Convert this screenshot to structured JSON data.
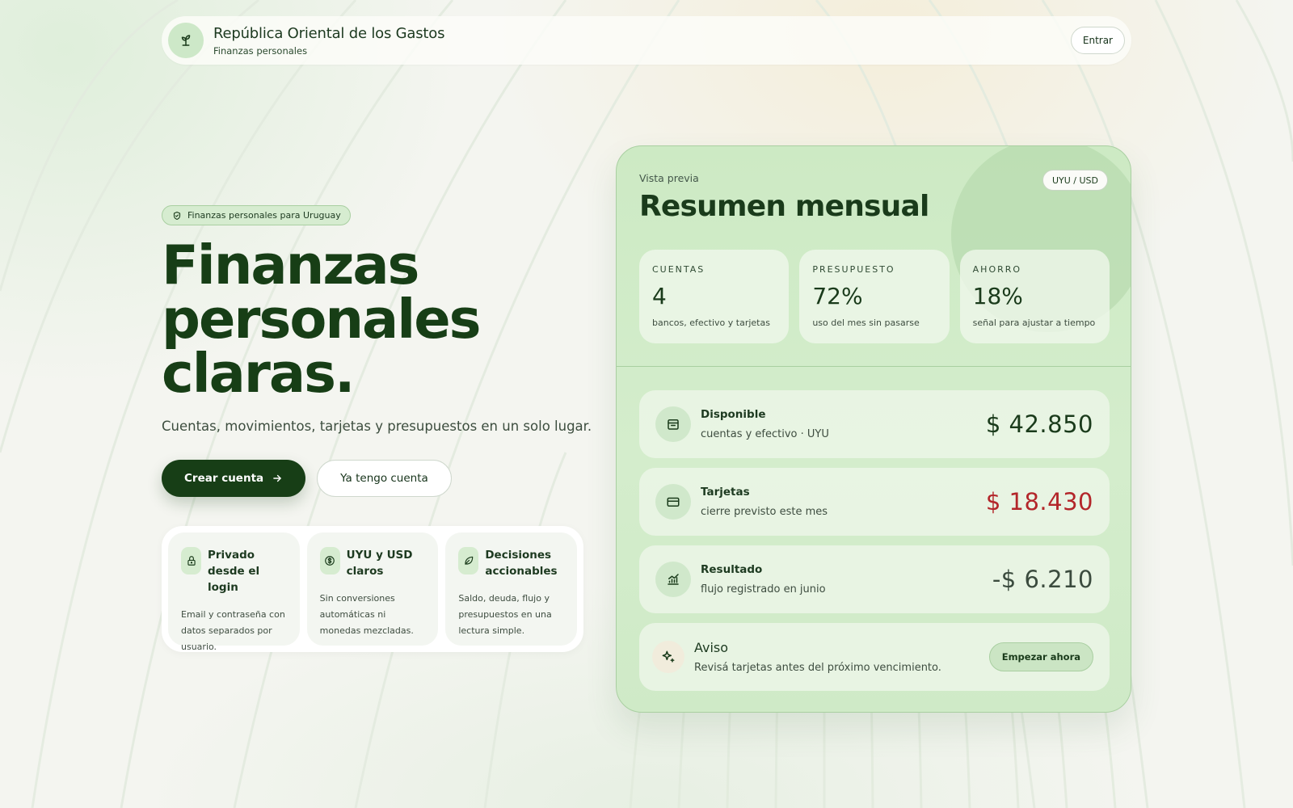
{
  "header": {
    "brand_title": "República Oriental de los Gastos",
    "brand_subtitle": "Finanzas personales",
    "logo_icon": "sprout-icon",
    "enter_label": "Entrar"
  },
  "hero": {
    "pill_icon": "shield-check-icon",
    "pill_label": "Finanzas personales para Uruguay",
    "title_line1": "Finanzas",
    "title_line2": "personales",
    "title_line3": "claras.",
    "subtitle": "Cuentas, movimientos, tarjetas y presupuestos en un solo lugar.",
    "primary_cta": "Crear cuenta",
    "secondary_cta": "Ya tengo cuenta"
  },
  "features": [
    {
      "icon": "lock-icon",
      "title": "Privado desde el login",
      "description": "Email y contraseña con datos separados por usuario."
    },
    {
      "icon": "dollar-circle-icon",
      "title": "UYU y USD claros",
      "description": "Sin conversiones automáticas ni monedas mezcladas."
    },
    {
      "icon": "leaf-icon",
      "title": "Decisiones accionables",
      "description": "Saldo, deuda, flujo y presupuestos en una lectura simple."
    }
  ],
  "preview": {
    "eyebrow": "Vista previa",
    "title": "Resumen mensual",
    "currency_pill": "UYU / USD",
    "stats": [
      {
        "label": "CUENTAS",
        "value": "4",
        "description": "bancos, efectivo y tarjetas"
      },
      {
        "label": "PRESUPUESTO",
        "value": "72%",
        "description": "uso del mes sin pasarse"
      },
      {
        "label": "AHORRO",
        "value": "18%",
        "description": "señal para ajustar a tiempo"
      }
    ],
    "rows": [
      {
        "icon": "wallet-icon",
        "label": "Disponible",
        "sub": "cuentas y efectivo · UYU",
        "amount": "$ 42.850",
        "color": "#1a3b1b"
      },
      {
        "icon": "credit-card-icon",
        "label": "Tarjetas",
        "sub": "cierre previsto este mes",
        "amount": "$ 18.430",
        "color": "#b3262a"
      },
      {
        "icon": "chart-up-icon",
        "label": "Resultado",
        "sub": "flujo registrado en junio",
        "amount": "-$ 6.210",
        "color": "#3b4b3e"
      }
    ],
    "alert": {
      "icon": "sparkles-icon",
      "title": "Aviso",
      "text": "Revisá tarjetas antes del próximo vencimiento.",
      "button": "Empezar ahora"
    }
  },
  "colors": {
    "brand_dark": "#173e16",
    "card_green": "#cdeac4",
    "negative_red": "#b3262a"
  }
}
